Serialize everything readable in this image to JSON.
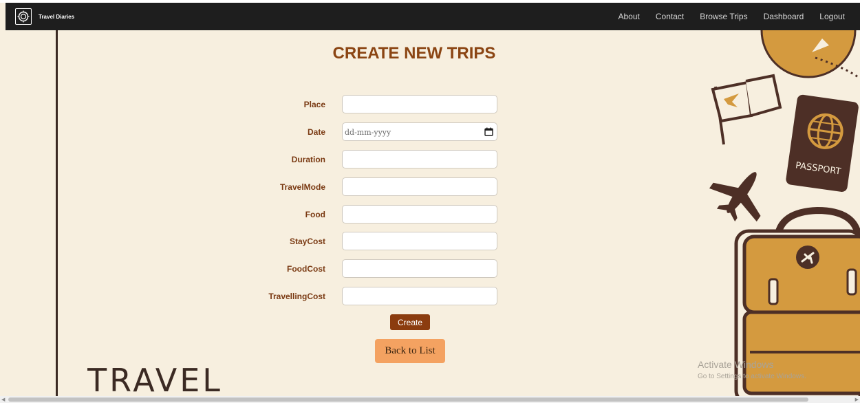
{
  "brand": {
    "name": "Travel Diaries"
  },
  "nav": {
    "links": [
      "About",
      "Contact",
      "Browse Trips",
      "Dashboard",
      "Logout"
    ]
  },
  "page": {
    "title": "CREATE NEW TRIPS"
  },
  "form": {
    "fields": [
      {
        "label": "Place",
        "value": ""
      },
      {
        "label": "Date",
        "value": "",
        "placeholder": "dd-mm-yyyy"
      },
      {
        "label": "Duration",
        "value": ""
      },
      {
        "label": "TravelMode",
        "value": ""
      },
      {
        "label": "Food",
        "value": ""
      },
      {
        "label": "StayCost",
        "value": ""
      },
      {
        "label": "FoodCost",
        "value": ""
      },
      {
        "label": "TravellingCost",
        "value": ""
      }
    ],
    "create_label": "Create",
    "back_label": "Back to List"
  },
  "decor": {
    "travel_word": "TRAVEL",
    "passport_text": "PASSPORT"
  },
  "watermark": {
    "title": "Activate Windows",
    "subtitle": "Go to Settings to activate Windows."
  },
  "colors": {
    "background": "#f7efdf",
    "navbar": "#1e1e1e",
    "title": "#8b4513",
    "create_button": "#8b3c0f",
    "back_button": "#f4a261",
    "decor_dark": "#4d2f26",
    "decor_gold": "#d49a3f"
  }
}
